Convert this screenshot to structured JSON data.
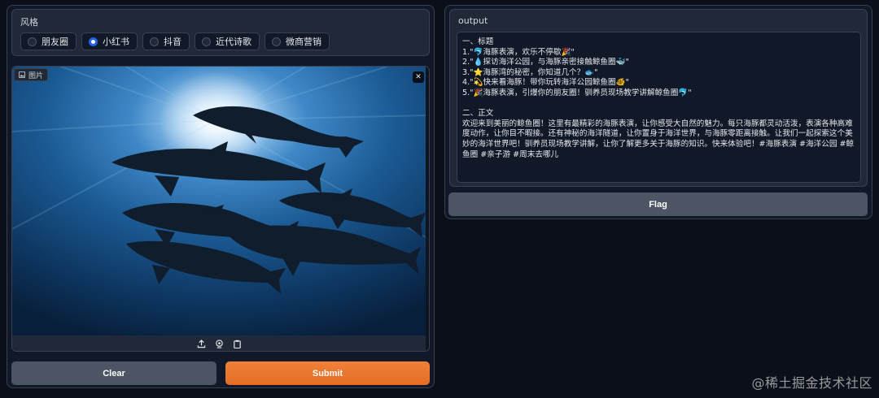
{
  "style_section": {
    "label": "风格",
    "options": [
      {
        "label": "朋友圈",
        "checked": false
      },
      {
        "label": "小红书",
        "checked": true
      },
      {
        "label": "抖音",
        "checked": false
      },
      {
        "label": "近代诗歌",
        "checked": false
      },
      {
        "label": "微商营销",
        "checked": false
      }
    ]
  },
  "image_section": {
    "label": "图片",
    "close_symbol": "✕"
  },
  "buttons": {
    "clear": "Clear",
    "submit": "Submit",
    "flag": "Flag"
  },
  "output": {
    "label": "output",
    "lines": [
      "一、标题",
      "1.\"🐬海豚表演，欢乐不停歇🎉\"",
      "2.\"💧探访海洋公园，与海豚亲密接触鲸鱼圈🐳\"",
      "3.\"⭐海豚湾的秘密，你知道几个？🐟\"",
      "4.\"💫快来看海豚！带你玩转海洋公园鲸鱼圈🐠\"",
      "5.\"🎉海豚表演，引爆你的朋友圈！驯养员现场教学讲解鲸鱼圈🐬\""
    ],
    "body_heading": "二、正文",
    "body": "欢迎来到美丽的鲸鱼圈！这里有最精彩的海豚表演，让你感受大自然的魅力。每只海豚都灵动活泼，表演各种高难度动作，让你目不暇接。还有神秘的海洋隧道，让你置身于海洋世界，与海豚零距离接触。让我们一起探索这个美妙的海洋世界吧！驯养员现场教学讲解，让你了解更多关于海豚的知识。快来体验吧！#海豚表演 #海洋公园 #鲸鱼圈 #亲子游 #周末去哪儿"
  },
  "watermark": "@稀土掘金技术社区",
  "colors": {
    "accent": "#2563eb",
    "submit": "#e8702a",
    "secondary_button": "#4b5563"
  }
}
